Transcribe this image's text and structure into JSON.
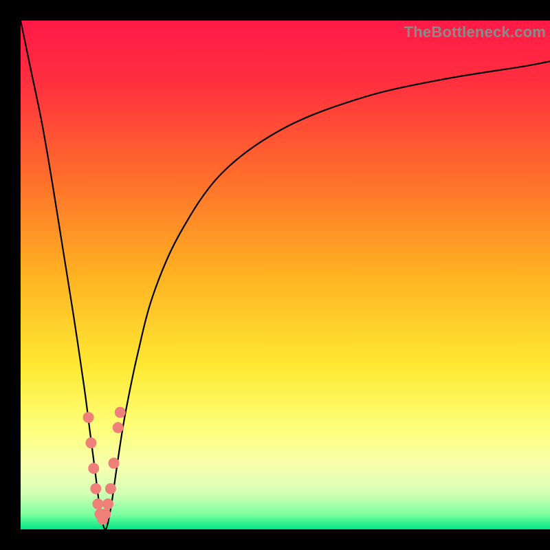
{
  "watermark": "TheBottleneck.com",
  "chart_data": {
    "type": "line",
    "title": "",
    "xlabel": "",
    "ylabel": "",
    "xlim": [
      0,
      100
    ],
    "ylim": [
      0,
      100
    ],
    "grid": false,
    "legend": false,
    "background_gradient": {
      "direction": "vertical",
      "stops": [
        {
          "pos": 0.0,
          "color": "#ff1a47"
        },
        {
          "pos": 0.12,
          "color": "#ff2f3f"
        },
        {
          "pos": 0.3,
          "color": "#ff6b2c"
        },
        {
          "pos": 0.5,
          "color": "#ffb222"
        },
        {
          "pos": 0.68,
          "color": "#ffe933"
        },
        {
          "pos": 0.8,
          "color": "#fdff7a"
        },
        {
          "pos": 0.88,
          "color": "#f6ffb0"
        },
        {
          "pos": 0.93,
          "color": "#d2ffb5"
        },
        {
          "pos": 0.97,
          "color": "#7effa0"
        },
        {
          "pos": 1.0,
          "color": "#00e682"
        }
      ]
    },
    "series": [
      {
        "name": "bottleneck-curve",
        "x": [
          0,
          2,
          4,
          6,
          8,
          10,
          12,
          13,
          14,
          15,
          16,
          17,
          18,
          19,
          20,
          22,
          25,
          30,
          38,
          50,
          65,
          80,
          95,
          100
        ],
        "y": [
          100,
          90,
          80,
          68,
          55,
          42,
          28,
          20,
          12,
          4,
          0,
          4,
          11,
          18,
          24,
          34,
          46,
          58,
          70,
          79,
          85,
          88.5,
          91,
          92
        ]
      }
    ],
    "markers": {
      "name": "salmon-dots",
      "color": "#ef8079",
      "points": [
        {
          "x": 12.8,
          "y": 22
        },
        {
          "x": 13.3,
          "y": 17
        },
        {
          "x": 13.8,
          "y": 12
        },
        {
          "x": 14.2,
          "y": 8
        },
        {
          "x": 14.6,
          "y": 5
        },
        {
          "x": 15.0,
          "y": 3
        },
        {
          "x": 15.5,
          "y": 2
        },
        {
          "x": 16.0,
          "y": 3
        },
        {
          "x": 16.5,
          "y": 5
        },
        {
          "x": 17.0,
          "y": 8
        },
        {
          "x": 17.6,
          "y": 13
        },
        {
          "x": 18.4,
          "y": 20
        },
        {
          "x": 18.8,
          "y": 23
        }
      ]
    }
  }
}
